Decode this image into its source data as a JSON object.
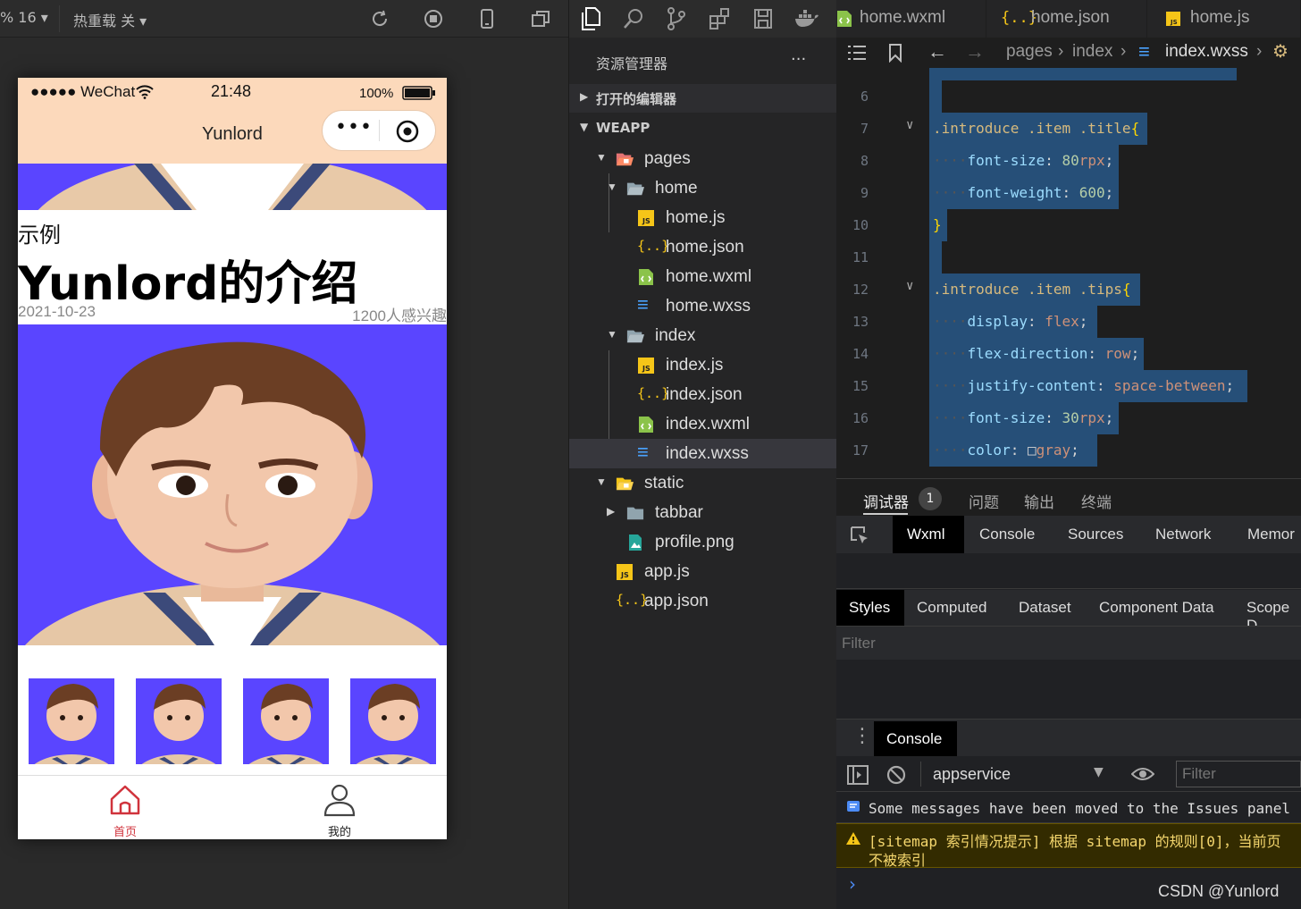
{
  "simulator": {
    "zoom": "% 16",
    "hot_reload": "热重载 关",
    "status_bar": {
      "carrier": "●●●●● WeChat",
      "time": "21:48",
      "battery": "100%"
    },
    "nav_title": "Yunlord",
    "intro": {
      "label": "示例",
      "title": "Yunlord的介绍",
      "date": "2021-10-23",
      "interest": "1200人感兴趣"
    },
    "tabbar": [
      {
        "label": "首页",
        "icon": "home-icon",
        "active": true,
        "color": "#d0333c"
      },
      {
        "label": "我的",
        "icon": "user-icon",
        "active": false,
        "color": "#222222"
      }
    ],
    "accent_bg": "#5a45ff",
    "nav_bg": "#fcd9bb"
  },
  "explorer": {
    "title": "资源管理器",
    "more": "···",
    "sections": {
      "open_editors": "打开的编辑器",
      "workspace": "WEAPP"
    },
    "tree": [
      {
        "label": "pages",
        "type": "folder-open-special",
        "depth": 0,
        "chevron": "▼"
      },
      {
        "label": "home",
        "type": "folder-open",
        "depth": 1,
        "chevron": "▼"
      },
      {
        "label": "home.js",
        "type": "js",
        "depth": 2
      },
      {
        "label": "home.json",
        "type": "json",
        "depth": 2
      },
      {
        "label": "home.wxml",
        "type": "wxml",
        "depth": 2
      },
      {
        "label": "home.wxss",
        "type": "wxss",
        "depth": 2
      },
      {
        "label": "index",
        "type": "folder-open",
        "depth": 1,
        "chevron": "▼"
      },
      {
        "label": "index.js",
        "type": "js",
        "depth": 2
      },
      {
        "label": "index.json",
        "type": "json",
        "depth": 2
      },
      {
        "label": "index.wxml",
        "type": "wxml",
        "depth": 2
      },
      {
        "label": "index.wxss",
        "type": "wxss",
        "depth": 2,
        "selected": true
      },
      {
        "label": "static",
        "type": "folder-open-special2",
        "depth": 0,
        "chevron": "▼"
      },
      {
        "label": "tabbar",
        "type": "folder",
        "depth": 1,
        "chevron": "▶"
      },
      {
        "label": "profile.png",
        "type": "png",
        "depth": 1
      },
      {
        "label": "app.js",
        "type": "js",
        "depth": 0
      },
      {
        "label": "app.json",
        "type": "json",
        "depth": 0
      }
    ]
  },
  "editor": {
    "tabs": [
      {
        "label": "home.wxml",
        "type": "wxml"
      },
      {
        "label": "home.json",
        "type": "json"
      },
      {
        "label": "home.js",
        "type": "js"
      }
    ],
    "breadcrumb": [
      "pages",
      "index",
      "index.wxss"
    ],
    "lines": [
      {
        "n": "6",
        "tokens": []
      },
      {
        "n": "7",
        "fold": true,
        "tokens": [
          [
            ".introduce .item .title",
            "sel"
          ],
          [
            "{",
            "brace"
          ]
        ]
      },
      {
        "n": "8",
        "tokens": [
          [
            "····",
            "dots"
          ],
          [
            "font-size",
            "prop"
          ],
          [
            ": ",
            "pun"
          ],
          [
            "80",
            "num"
          ],
          [
            "rpx",
            "unit"
          ],
          [
            ";",
            "pun"
          ]
        ]
      },
      {
        "n": "9",
        "tokens": [
          [
            "····",
            "dots"
          ],
          [
            "font-weight",
            "prop"
          ],
          [
            ": ",
            "pun"
          ],
          [
            "600",
            "num"
          ],
          [
            ";",
            "pun"
          ]
        ]
      },
      {
        "n": "10",
        "tokens": [
          [
            "}",
            "brace"
          ]
        ]
      },
      {
        "n": "11",
        "tokens": []
      },
      {
        "n": "12",
        "fold": true,
        "tokens": [
          [
            ".introduce .item .tips",
            "sel"
          ],
          [
            "{",
            "brace"
          ]
        ]
      },
      {
        "n": "13",
        "tokens": [
          [
            "····",
            "dots"
          ],
          [
            "display",
            "prop"
          ],
          [
            ": ",
            "pun"
          ],
          [
            "flex",
            "val"
          ],
          [
            ";",
            "pun"
          ]
        ]
      },
      {
        "n": "14",
        "tokens": [
          [
            "····",
            "dots"
          ],
          [
            "flex-direction",
            "prop"
          ],
          [
            ": ",
            "pun"
          ],
          [
            "row",
            "val"
          ],
          [
            ";",
            "pun"
          ]
        ]
      },
      {
        "n": "15",
        "tokens": [
          [
            "····",
            "dots"
          ],
          [
            "justify-content",
            "prop"
          ],
          [
            ": ",
            "pun"
          ],
          [
            "space-between",
            "val"
          ],
          [
            ";",
            "pun"
          ]
        ]
      },
      {
        "n": "16",
        "tokens": [
          [
            "····",
            "dots"
          ],
          [
            "font-size",
            "prop"
          ],
          [
            ": ",
            "pun"
          ],
          [
            "30",
            "num"
          ],
          [
            "rpx",
            "unit"
          ],
          [
            ";",
            "pun"
          ]
        ]
      },
      {
        "n": "17",
        "tokens": [
          [
            "····",
            "dots"
          ],
          [
            "color",
            "prop"
          ],
          [
            ": ",
            "pun"
          ],
          [
            "□",
            "pun"
          ],
          [
            "gray",
            "val"
          ],
          [
            ";",
            "pun"
          ]
        ]
      }
    ]
  },
  "devtools": {
    "panel_tabs": {
      "debugger": "调试器",
      "badge": "1",
      "issues": "问题",
      "output": "输出",
      "terminal": "终端"
    },
    "tool_tabs": [
      "Wxml",
      "Console",
      "Sources",
      "Network",
      "Memor"
    ],
    "style_tabs": [
      "Styles",
      "Computed",
      "Dataset",
      "Component Data",
      "Scope D"
    ],
    "filter_placeholder": "Filter",
    "console_tab": "Console",
    "context": "appservice",
    "console_filter": "Filter",
    "messages": [
      {
        "type": "info",
        "text": "Some messages have been moved to the Issues panel"
      },
      {
        "type": "warn",
        "text": "[sitemap 索引情况提示] 根据 sitemap 的规则[0]，当前页",
        "text2": "不被索引"
      }
    ],
    "prompt": "›",
    "watermark": "CSDN @Yunlord"
  }
}
